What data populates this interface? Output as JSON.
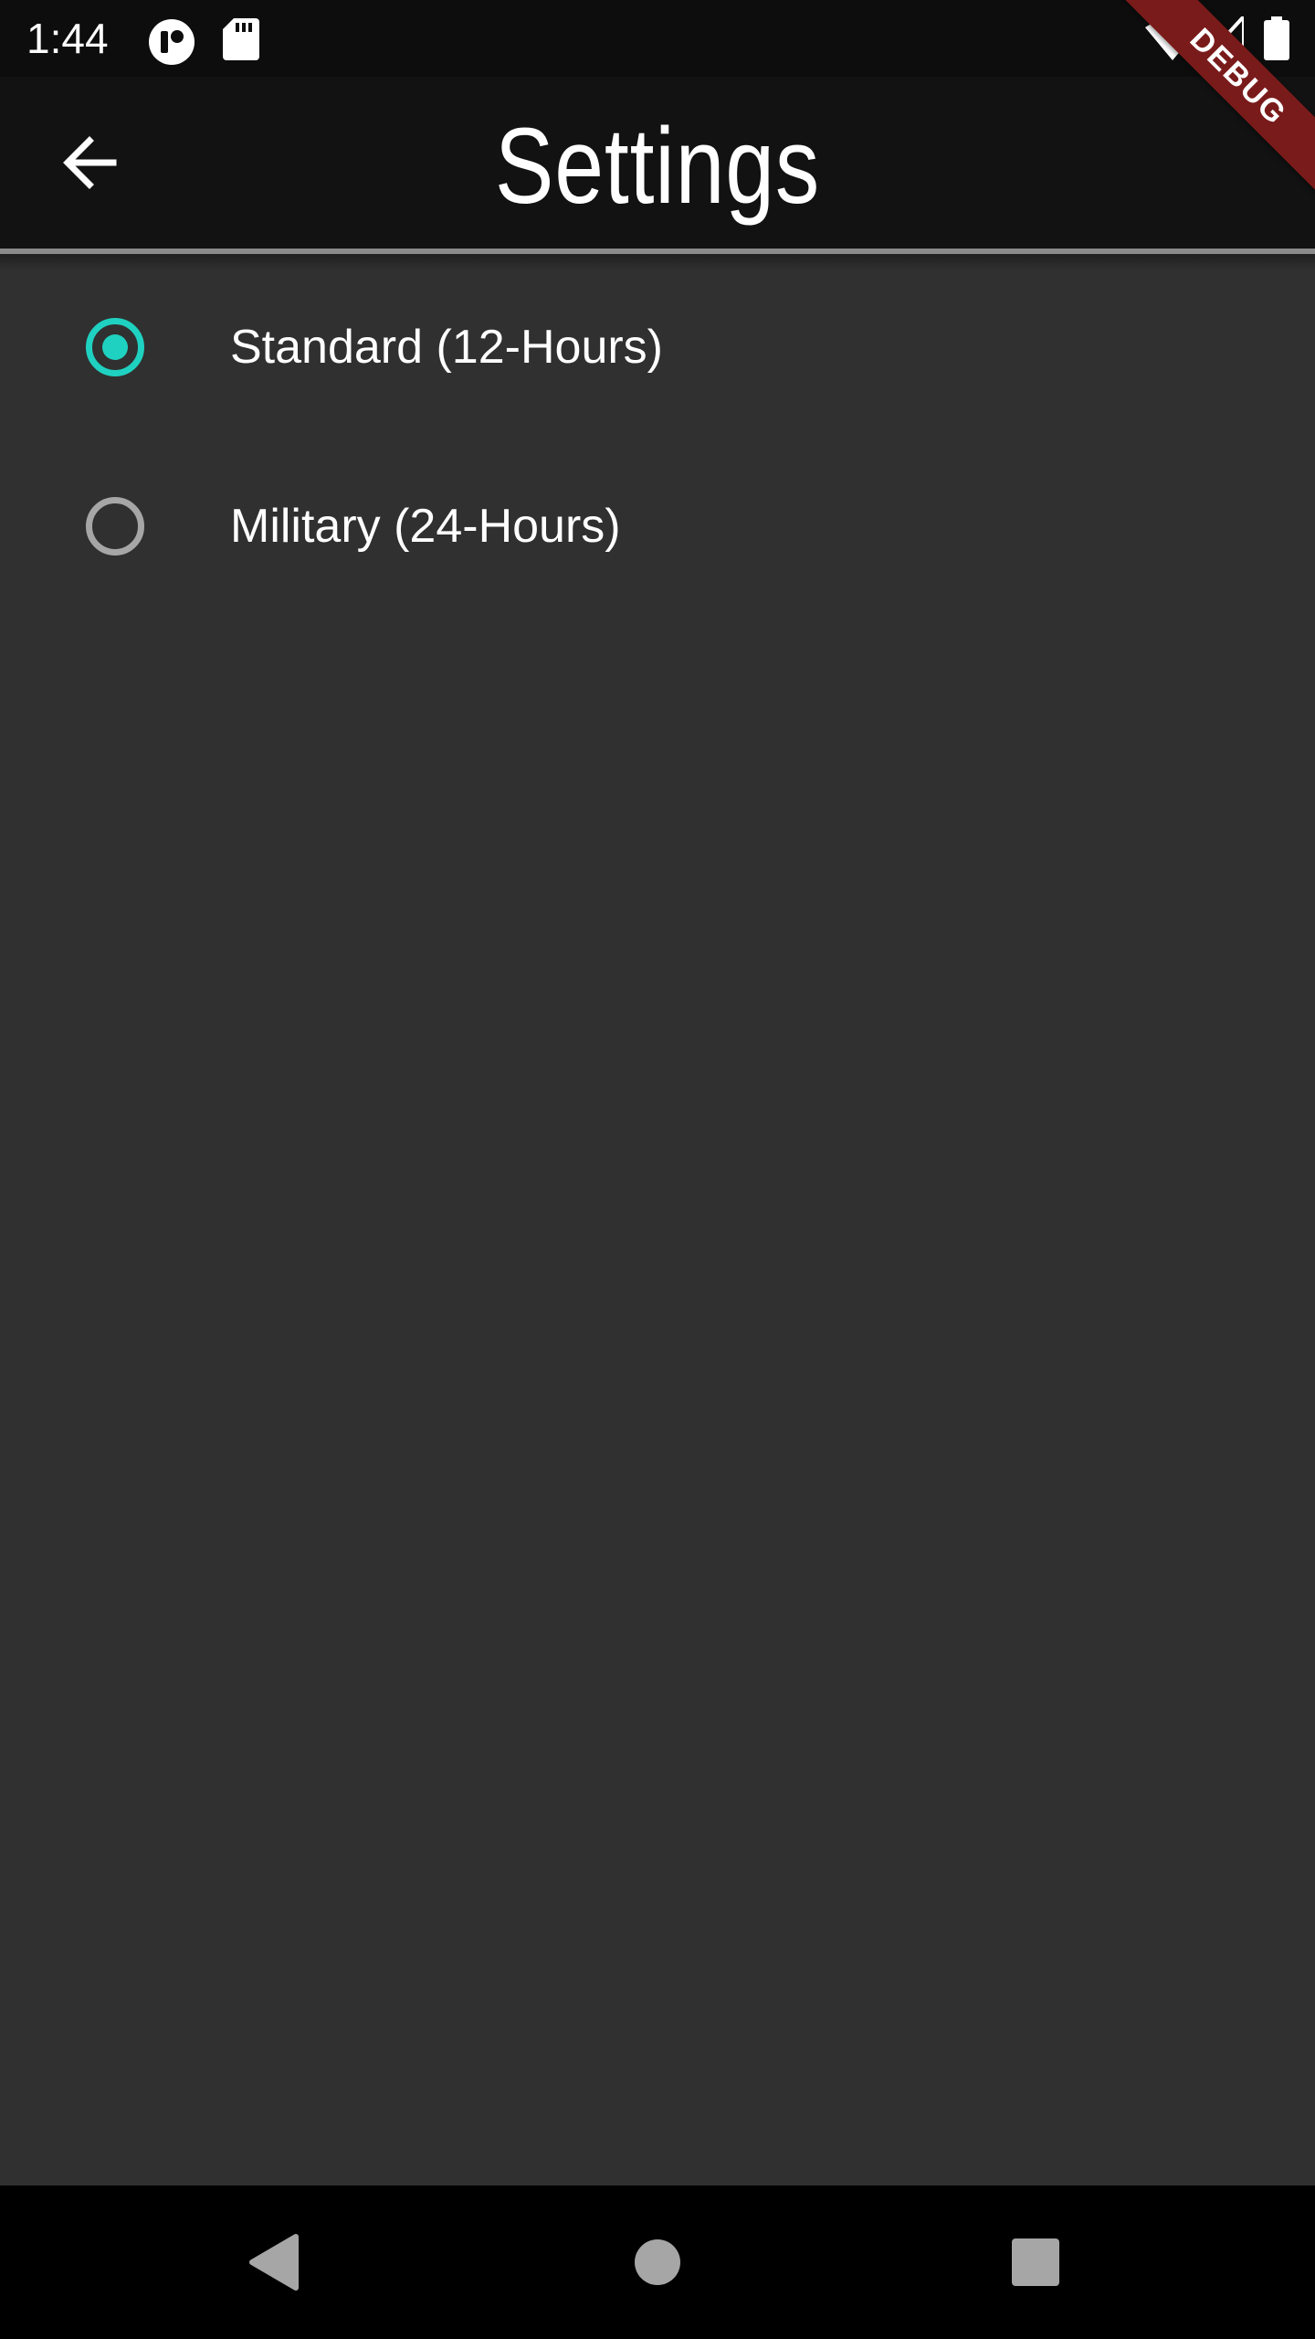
{
  "status_bar": {
    "time": "1:44",
    "icons": [
      "notification-app-icon",
      "sd-card-icon",
      "wifi-icon",
      "cell-signal-icon",
      "battery-icon"
    ]
  },
  "debug_banner": {
    "label": "DEBUG",
    "color": "#7a1b1b"
  },
  "app_bar": {
    "title": "Settings",
    "back_icon": "arrow-back-icon"
  },
  "time_format": {
    "accent_color": "#1fd1c0",
    "options": [
      {
        "label": "Standard (12-Hours)",
        "selected": true
      },
      {
        "label": "Military (24-Hours)",
        "selected": false
      }
    ]
  },
  "nav_bar": {
    "buttons": [
      "back-triangle-icon",
      "home-circle-icon",
      "recents-square-icon"
    ]
  }
}
